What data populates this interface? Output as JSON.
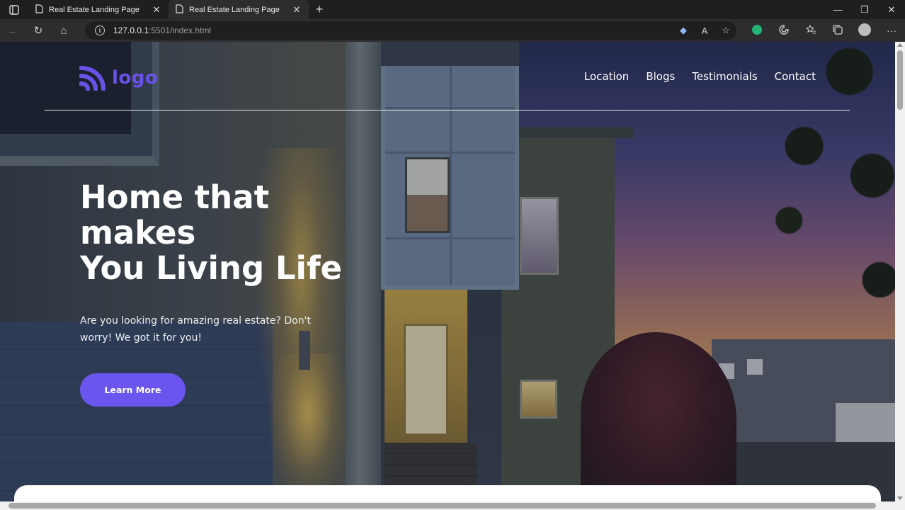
{
  "browser": {
    "tabs": [
      {
        "title": "Real Estate Landing Page",
        "active": false
      },
      {
        "title": "Real Estate Landing Page",
        "active": true
      }
    ],
    "url_host": "127.0.0.1",
    "url_rest": ":5501/index.html",
    "icons": {
      "tab_actions": "tab-actions-icon",
      "page": "page-icon",
      "close": "close-icon",
      "new_tab": "plus-icon",
      "back": "back-arrow-icon",
      "reload": "reload-icon",
      "home": "home-icon",
      "site_info": "info-icon",
      "minimize": "minimize-icon",
      "maximize": "restore-icon",
      "window_close": "window-close-icon"
    },
    "glyphs": {
      "close": "✕",
      "new_tab": "+",
      "back": "←",
      "reload": "↻",
      "home": "⌂",
      "info": "i",
      "minimize": "—",
      "restore": "❐",
      "window_close": "✕",
      "menu": "···",
      "favorites": "☆",
      "read_aloud": "A",
      "extension": "◆"
    }
  },
  "site": {
    "logo_text": "logo",
    "brand_color": "#6a52e8",
    "nav": [
      "Location",
      "Blogs",
      "Testimonials",
      "Contact"
    ],
    "headline_lines": [
      "Home that",
      "makes",
      "You Living Life"
    ],
    "subtext": "Are you looking for amazing real estate? Don't worry! We got it for you!",
    "cta_label": "Learn More",
    "cta_color": "#6a55ee"
  }
}
